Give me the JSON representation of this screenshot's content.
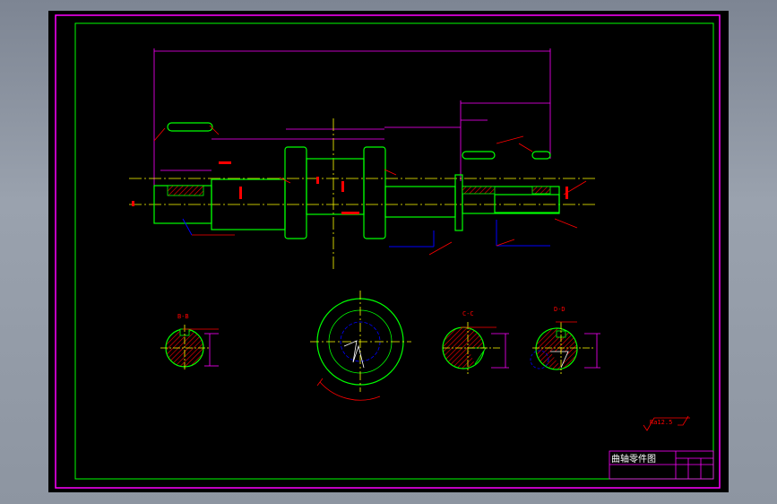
{
  "colors": {
    "border": "#ff00ff",
    "frame": "#00ff00",
    "outline": "#00ff00",
    "dim": "#ff00ff",
    "note": "#ff0000",
    "center": "#ffff00",
    "hidden": "#0000ff",
    "text_white": "#ffffff"
  },
  "title_block": {
    "title": "曲轴零件图"
  },
  "section_labels": {
    "b": "B-B",
    "c": "C-C",
    "d": "D-D"
  },
  "surface_note": "Ra12.5"
}
